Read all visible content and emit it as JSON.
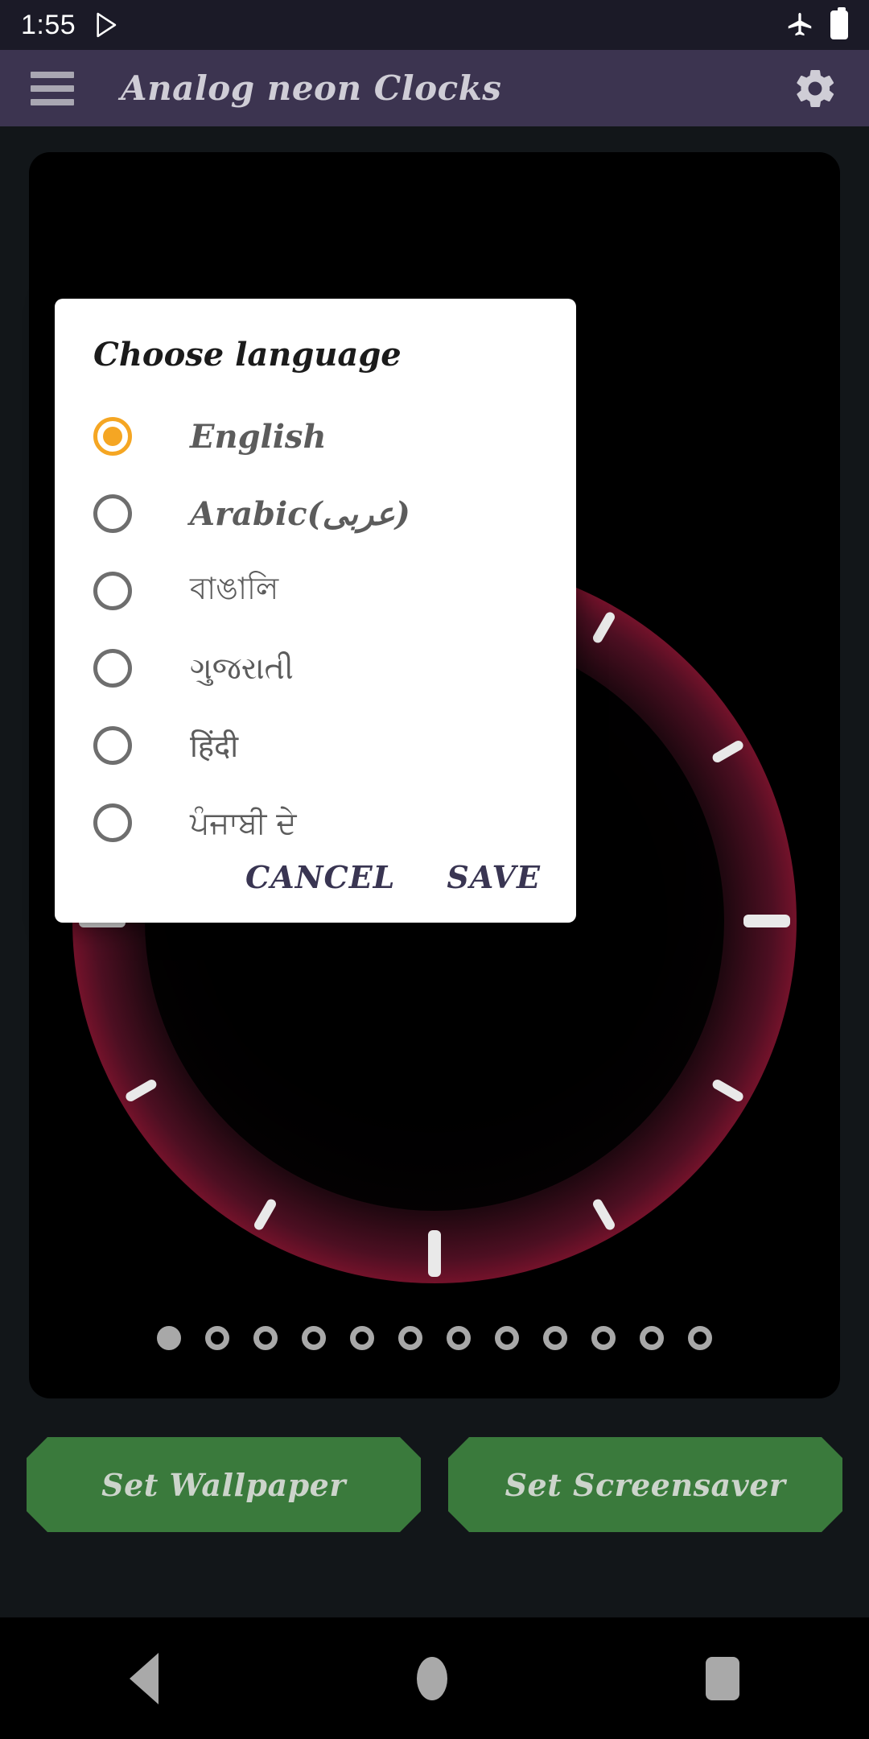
{
  "status_bar": {
    "time": "1:55",
    "play_icon": "play-store-icon",
    "airplane_icon": "airplane-mode-icon",
    "battery_icon": "battery-full-icon"
  },
  "app_bar": {
    "menu_icon": "hamburger-menu-icon",
    "title": "Analog neon Clocks",
    "settings_icon": "gear-icon"
  },
  "carousel": {
    "total_dots": 12,
    "active_index": 0
  },
  "actions": {
    "set_wallpaper": "Set Wallpaper",
    "set_screensaver": "Set Screensaver"
  },
  "dialog": {
    "title": "Choose language",
    "options": [
      {
        "label": "English",
        "selected": true,
        "script": true
      },
      {
        "label": "Arabic(عربی)",
        "selected": false,
        "script": true
      },
      {
        "label": "বাঙালি",
        "selected": false,
        "script": false
      },
      {
        "label": "ગુજરાતી",
        "selected": false,
        "script": false
      },
      {
        "label": "हिंदी",
        "selected": false,
        "script": false
      },
      {
        "label": "ਪੰਜਾਬੀ ਦੇ",
        "selected": false,
        "script": false
      }
    ],
    "cancel_label": "CANCEL",
    "save_label": "SAVE"
  },
  "nav_bar": {
    "back": "back-button",
    "home": "home-button",
    "recents": "recents-button"
  },
  "colors": {
    "app_bar": "#3c3450",
    "status_bar": "#1b1a27",
    "accent_selected": "#f5a623",
    "action_button": "#3a7a3c",
    "dialog_button_text": "#393552",
    "page_background": "#121619"
  }
}
